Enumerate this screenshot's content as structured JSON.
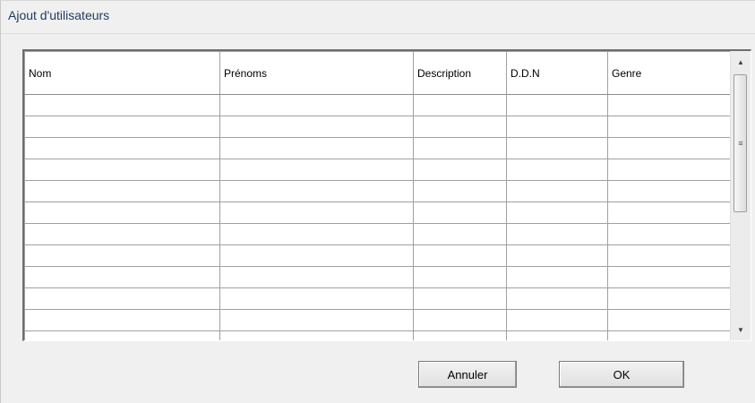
{
  "window": {
    "title": "Ajout d'utilisateurs"
  },
  "grid": {
    "columns": [
      "Nom",
      "Prénoms",
      "Description",
      "D.D.N",
      "Genre"
    ],
    "rows": [
      [
        "",
        "",
        "",
        "",
        ""
      ],
      [
        "",
        "",
        "",
        "",
        ""
      ],
      [
        "",
        "",
        "",
        "",
        ""
      ],
      [
        "",
        "",
        "",
        "",
        ""
      ],
      [
        "",
        "",
        "",
        "",
        ""
      ],
      [
        "",
        "",
        "",
        "",
        ""
      ],
      [
        "",
        "",
        "",
        "",
        ""
      ],
      [
        "",
        "",
        "",
        "",
        ""
      ],
      [
        "",
        "",
        "",
        "",
        ""
      ],
      [
        "",
        "",
        "",
        "",
        ""
      ],
      [
        "",
        "",
        "",
        "",
        ""
      ],
      [
        "",
        "",
        "",
        "",
        ""
      ]
    ]
  },
  "scrollbar": {
    "up_icon": "triangle-up-icon",
    "down_icon": "triangle-down-icon",
    "grip_icon": "grip-icon",
    "position": 0.0
  },
  "buttons": {
    "cancel_label": "Annuler",
    "ok_label": "OK"
  }
}
